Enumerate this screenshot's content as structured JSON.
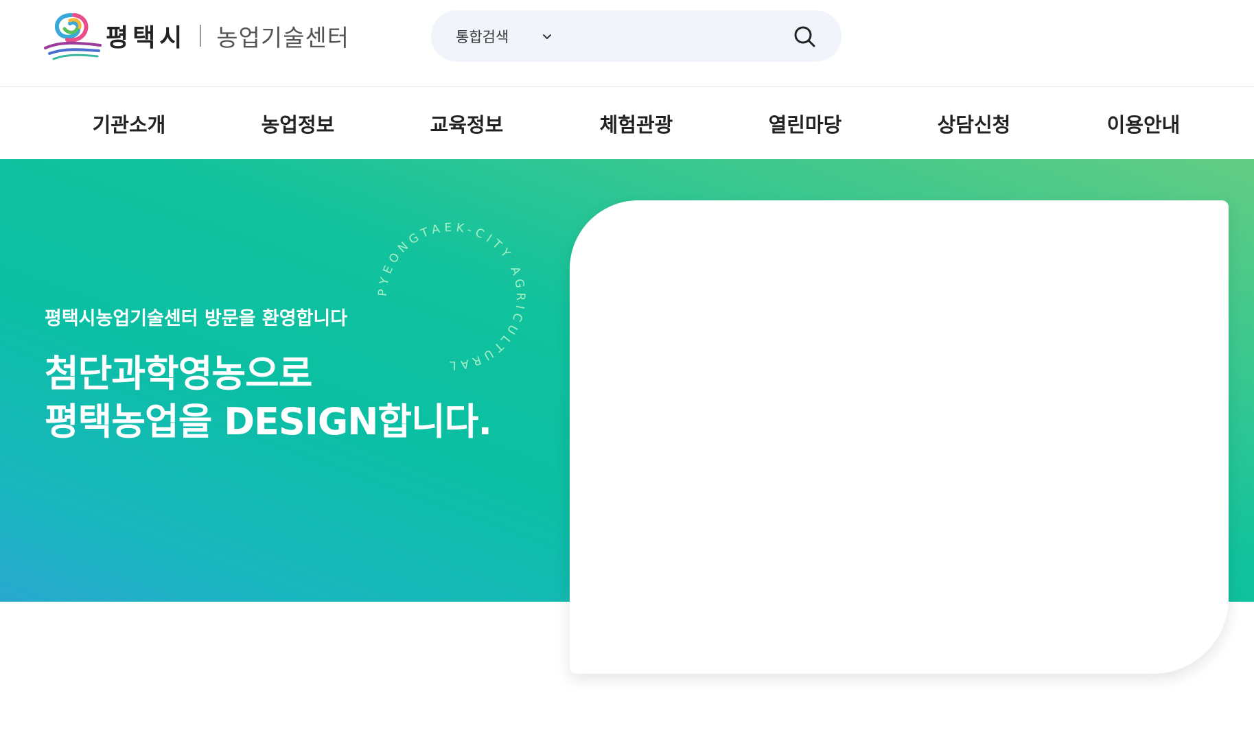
{
  "header": {
    "logo_city": "평택시",
    "logo_center": "농업기술센터",
    "search": {
      "select_label": "통합검색",
      "placeholder": ""
    }
  },
  "nav": {
    "items": [
      {
        "label": "기관소개"
      },
      {
        "label": "농업정보"
      },
      {
        "label": "교육정보"
      },
      {
        "label": "체험관광"
      },
      {
        "label": "열린마당"
      },
      {
        "label": "상담신청"
      },
      {
        "label": "이용안내"
      }
    ]
  },
  "hero": {
    "subtitle": "평택시농업기술센터 방문을 환영합니다",
    "title_line1": "첨단과학영농으로",
    "title_line2": "평택농업을 DESIGN합니다.",
    "circle_text": "PYEONGTAEK-CITY AGRICULTURAL",
    "colors": {
      "gradient_start": "#63cc83",
      "gradient_mid": "#0bbfa3",
      "gradient_end": "#28a8cf"
    }
  },
  "icons": {
    "logo": "pyeongtaek-logo-icon",
    "chevron": "chevron-down-icon",
    "search": "search-icon"
  }
}
